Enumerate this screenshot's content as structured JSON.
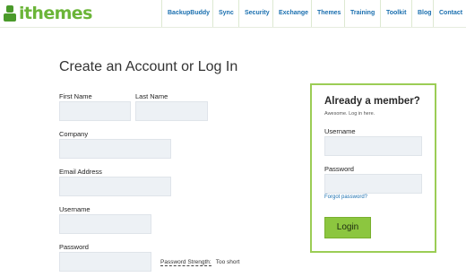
{
  "brand": {
    "logo_text": "ithemes",
    "logo_icon": "person-icon",
    "accent_color": "#6bb538",
    "link_color": "#1a6faf"
  },
  "nav": {
    "items": [
      {
        "label": "BackupBuddy"
      },
      {
        "label": "Sync"
      },
      {
        "label": "Security"
      },
      {
        "label": "Exchange"
      },
      {
        "label": "Themes"
      },
      {
        "label": "Training"
      },
      {
        "label": "Toolkit"
      },
      {
        "label": "Blog"
      },
      {
        "label": "Contact"
      }
    ]
  },
  "signup": {
    "title": "Create an Account or Log In",
    "first_name_label": "First Name",
    "last_name_label": "Last Name",
    "company_label": "Company",
    "email_label": "Email Address",
    "username_label": "Username",
    "password_label": "Password",
    "password_strength_label": "Password Strength:",
    "password_strength_value": "Too short"
  },
  "member": {
    "title": "Already a member?",
    "subtitle": "Awesome. Log in here.",
    "username_label": "Username",
    "password_label": "Password",
    "forgot_label": "Forgot password?",
    "login_label": "Login",
    "box_border_color": "#9bcd55",
    "button_color": "#8cc63f"
  }
}
